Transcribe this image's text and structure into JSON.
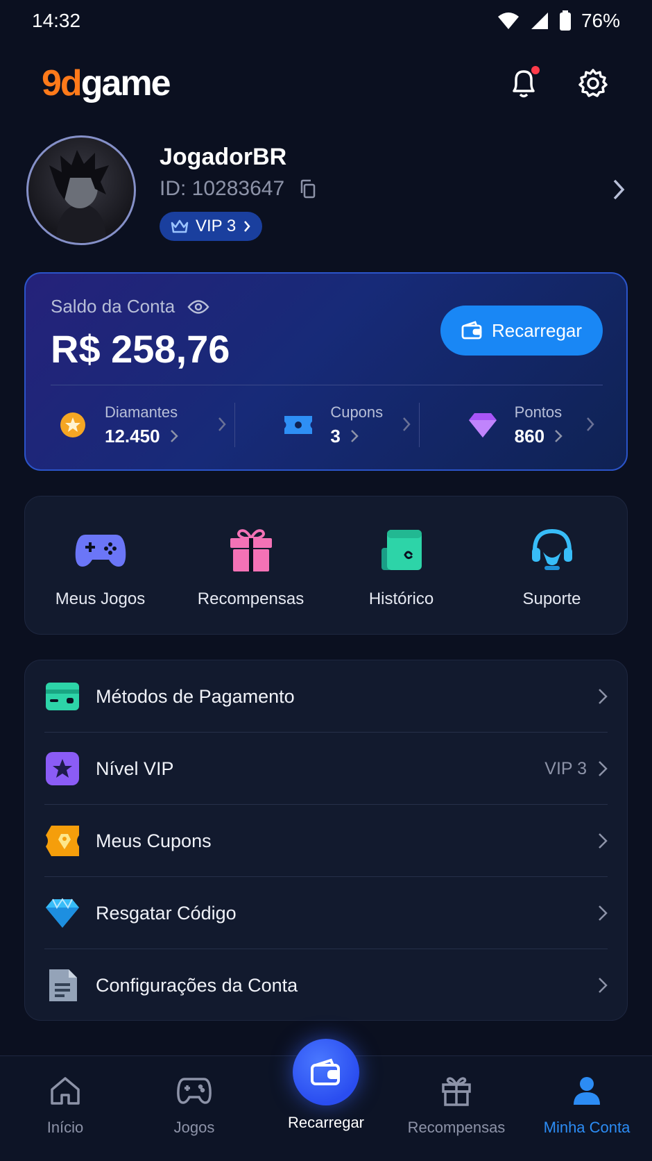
{
  "status_bar": {
    "time": "14:32",
    "battery": "76%"
  },
  "header": {
    "logo_accent": "9d",
    "logo_rest": "game",
    "accent_color": "#ff7a1a"
  },
  "profile": {
    "username": "JogadorBR",
    "id_label": "ID: 10283647",
    "vip_label": "VIP 3"
  },
  "balance": {
    "label": "Saldo da Conta",
    "amount": "R$ 258,76",
    "recharge_label": "Recarregar",
    "stats": [
      {
        "label": "Diamantes",
        "value": "12.450"
      },
      {
        "label": "Cupons",
        "value": "3"
      },
      {
        "label": "Pontos",
        "value": "860"
      }
    ]
  },
  "quick_actions": [
    {
      "label": "Meus Jogos",
      "icon": "gamepad-icon"
    },
    {
      "label": "Recompensas",
      "icon": "gift-icon"
    },
    {
      "label": "Histórico",
      "icon": "wallet-history-icon"
    },
    {
      "label": "Suporte",
      "icon": "headset-icon"
    }
  ],
  "menu": [
    {
      "label": "Métodos de Pagamento",
      "value": "",
      "icon": "card-icon"
    },
    {
      "label": "Nível VIP",
      "value": "VIP 3",
      "icon": "star-icon"
    },
    {
      "label": "Meus Cupons",
      "value": "",
      "icon": "coupon-icon"
    },
    {
      "label": "Resgatar Código",
      "value": "",
      "icon": "diamond-icon"
    },
    {
      "label": "Configurações da Conta",
      "value": "",
      "icon": "document-icon"
    }
  ],
  "bottom_nav": [
    {
      "label": "Início"
    },
    {
      "label": "Jogos"
    },
    {
      "label": "Recarregar"
    },
    {
      "label": "Recompensas"
    },
    {
      "label": "Minha Conta"
    }
  ],
  "colors": {
    "primary": "#1987f5",
    "active_nav": "#2c8cf4",
    "background": "#0b1020"
  }
}
